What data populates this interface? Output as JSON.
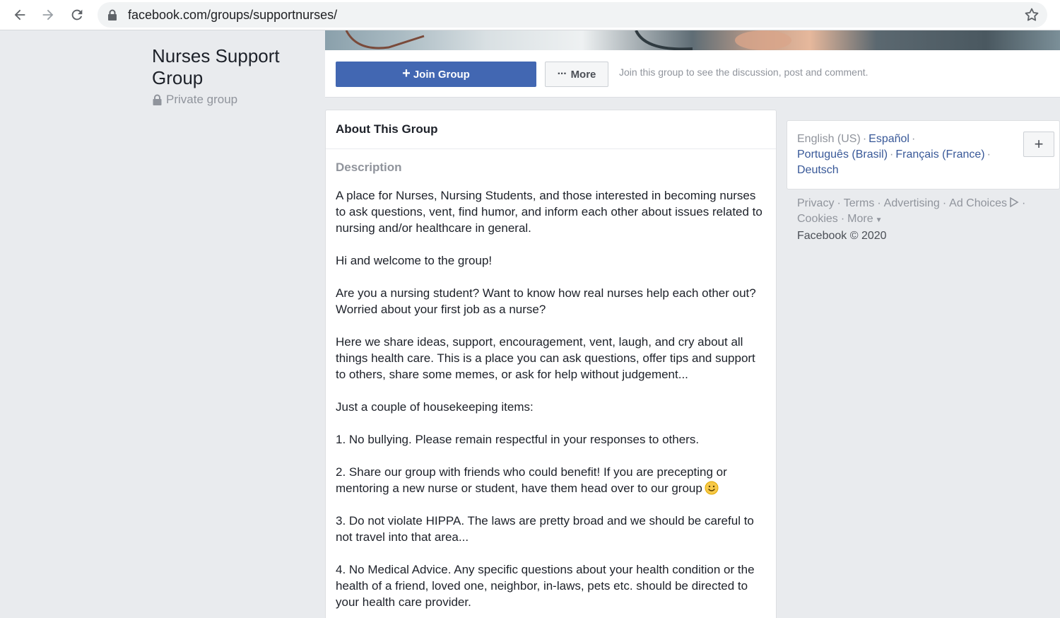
{
  "browser": {
    "url": "facebook.com/groups/supportnurses/"
  },
  "group": {
    "title": "Nurses Support Group",
    "privacy": "Private group"
  },
  "actions": {
    "join_label": "Join Group",
    "more_label": "More",
    "hint": "Join this group to see the discussion, post and comment."
  },
  "about": {
    "heading": "About This Group",
    "description_label": "Description",
    "paragraphs": [
      "A place for Nurses, Nursing Students, and those interested in becoming nurses to ask questions, vent, find humor, and inform each other about issues related to nursing and/or healthcare in general.",
      "Hi and welcome to the group!",
      "Are you a nursing student? Want to know how real nurses help each other out? Worried about your first job as a nurse?",
      "Here we share ideas, support, encouragement, vent, laugh, and cry about all things health care. This is a place you can ask questions, offer tips and support to others, share some memes, or ask for help without judgement...",
      "Just a couple of housekeeping items:",
      "1. No bullying. Please remain respectful in your responses to others.",
      "2. Share our group with friends who could benefit! If you are precepting or mentoring a new nurse or student, have them head over to our group",
      "3. Do not violate HIPPA. The laws are pretty broad and we should be careful to not travel into that area...",
      "4. No Medical Advice. Any specific questions about your health condition or the health of a friend, loved one, neighbor, in-laws, pets etc. should be directed to your health care provider."
    ]
  },
  "languages": {
    "current": "English (US)",
    "options": [
      "Español",
      "Português (Brasil)",
      "Français (France)",
      "Deutsch"
    ]
  },
  "footer": {
    "privacy": "Privacy",
    "terms": "Terms",
    "advertising": "Advertising",
    "ad_choices": "Ad Choices",
    "cookies": "Cookies",
    "more": "More",
    "copyright": "Facebook © 2020"
  }
}
